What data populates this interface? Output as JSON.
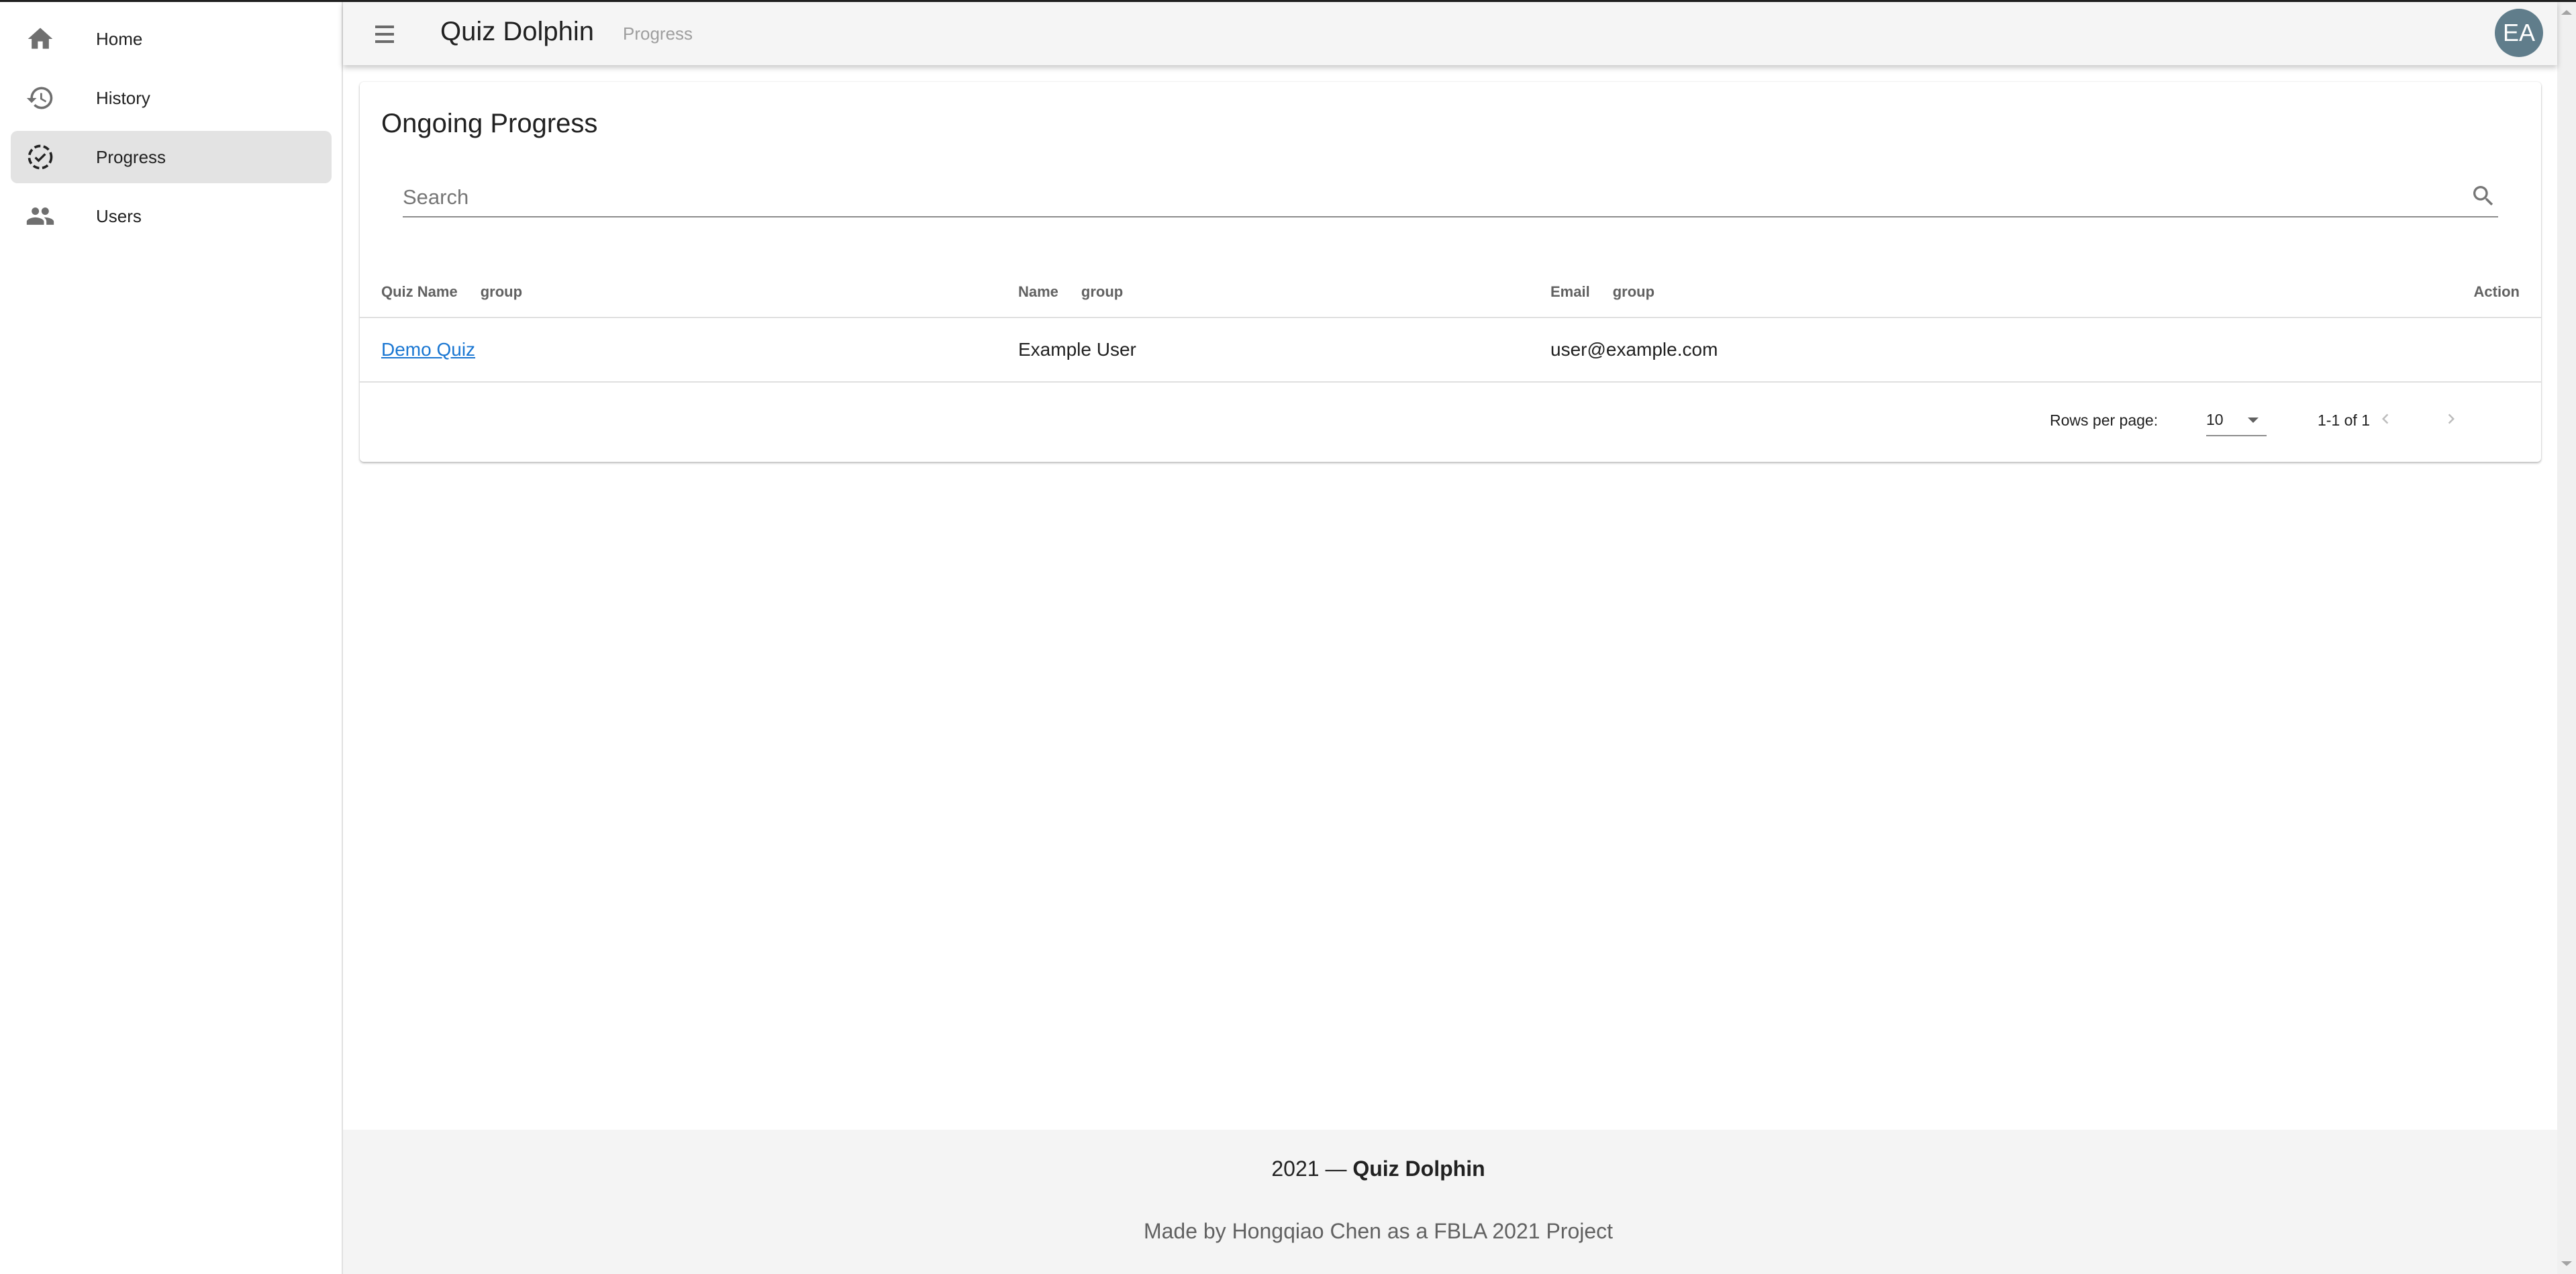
{
  "sidebar": {
    "items": [
      {
        "label": "Home",
        "icon": "home-icon",
        "active": false
      },
      {
        "label": "History",
        "icon": "history-icon",
        "active": false
      },
      {
        "label": "Progress",
        "icon": "progress-check-icon",
        "active": true
      },
      {
        "label": "Users",
        "icon": "users-icon",
        "active": false
      }
    ]
  },
  "appbar": {
    "title": "Quiz Dolphin",
    "subtitle": "Progress",
    "avatar_initials": "EA",
    "avatar_color": "#607d8b"
  },
  "card": {
    "title": "Ongoing Progress",
    "search": {
      "placeholder": "Search",
      "value": ""
    }
  },
  "table": {
    "columns": [
      {
        "label": "Quiz Name",
        "group": "group"
      },
      {
        "label": "Name",
        "group": "group"
      },
      {
        "label": "Email",
        "group": "group"
      },
      {
        "label": "Action"
      }
    ],
    "rows": [
      {
        "quiz_name": "Demo Quiz",
        "name": "Example User",
        "email": "user@example.com",
        "action": ""
      }
    ]
  },
  "pagination": {
    "rows_per_page_label": "Rows per page:",
    "rows_per_page": "10",
    "range": "1-1 of 1"
  },
  "footer": {
    "year_prefix": "2021 — ",
    "brand": "Quiz Dolphin",
    "credit": "Made by Hongqiao Chen as a FBLA 2021 Project"
  },
  "colors": {
    "link": "#1976d2",
    "header_bg": "#f5f5f5",
    "active_nav_bg": "#e3e3e3"
  }
}
